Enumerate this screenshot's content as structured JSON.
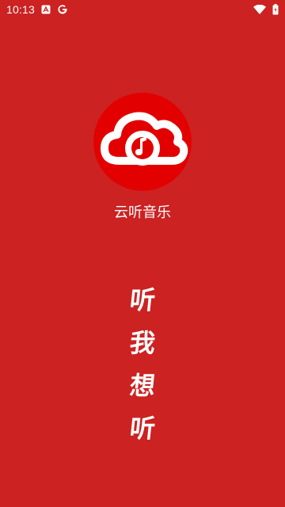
{
  "status_bar": {
    "time": "10:13",
    "icons": [
      "a-notification-icon",
      "google-icon",
      "wifi-icon",
      "battery-icon"
    ]
  },
  "splash": {
    "app_name": "云听音乐",
    "logo_icon": "cloud-music-note-icon",
    "slogan": [
      "听",
      "我",
      "想",
      "听"
    ]
  },
  "colors": {
    "background": "#cc2222",
    "logo_circle": "#e30000",
    "foreground": "#ffffff"
  }
}
